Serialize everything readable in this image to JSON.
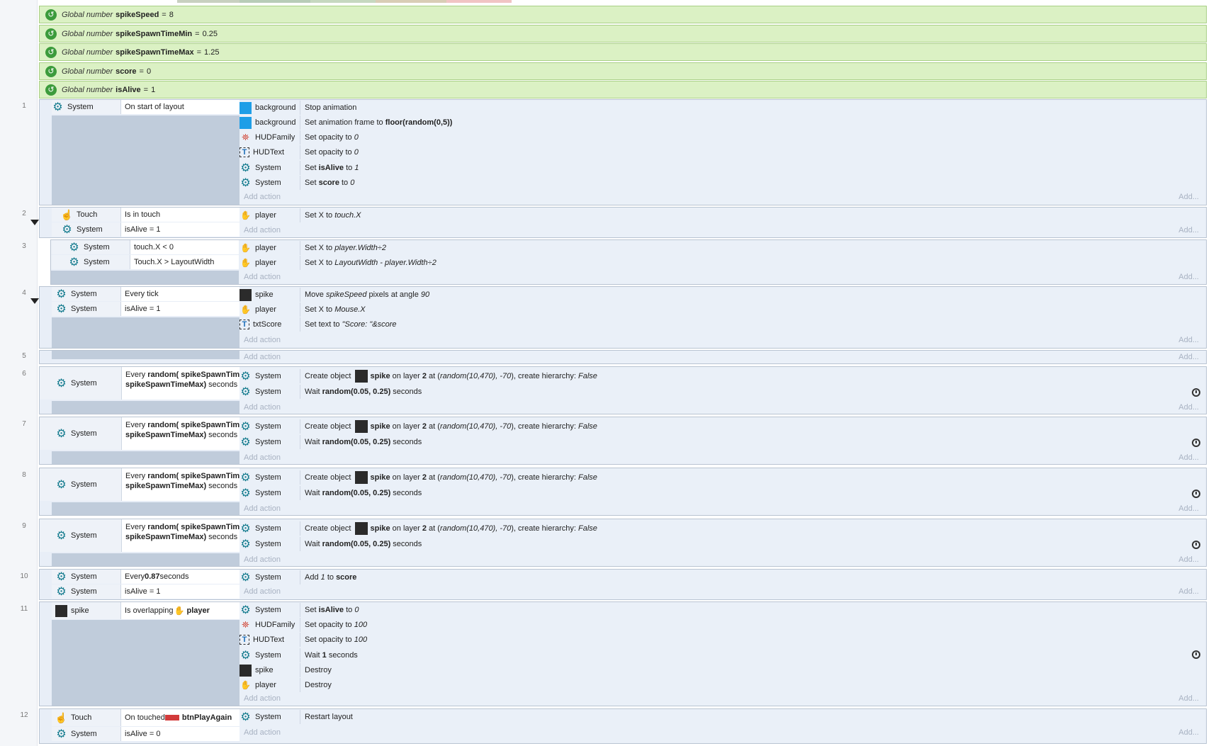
{
  "globals": [
    {
      "kw": "Global number",
      "name": "spikeSpeed",
      "eq": "=",
      "value": "8"
    },
    {
      "kw": "Global number",
      "name": "spikeSpawnTimeMin",
      "eq": "=",
      "value": "0.25"
    },
    {
      "kw": "Global number",
      "name": "spikeSpawnTimeMax",
      "eq": "=",
      "value": "1.25"
    },
    {
      "kw": "Global number",
      "name": "score",
      "eq": "=",
      "value": "0"
    },
    {
      "kw": "Global number",
      "name": "isAlive",
      "eq": "=",
      "value": "1"
    }
  ],
  "labels": {
    "add_action": "Add action",
    "add": "Add..."
  },
  "events": {
    "e1": {
      "num": "1",
      "c1": {
        "obj": "System",
        "text": "On start of layout"
      },
      "a1": {
        "obj": "background",
        "text": "Stop animation"
      },
      "a2": {
        "obj": "background",
        "pre": "Set animation frame to ",
        "b": "floor(random(0,5))"
      },
      "a3": {
        "obj": "HUDFamily",
        "pre": "Set opacity to ",
        "i": "0"
      },
      "a4": {
        "obj": "HUDText",
        "pre": "Set opacity to ",
        "i": "0"
      },
      "a5": {
        "obj": "System",
        "pre": "Set ",
        "b": "isAlive",
        "mid": " to ",
        "i": "1"
      },
      "a6": {
        "obj": "System",
        "pre": "Set ",
        "b": "score",
        "mid": " to ",
        "i": "0"
      }
    },
    "e2": {
      "num": "2",
      "c1": {
        "obj": "Touch",
        "text": "Is in touch"
      },
      "c2": {
        "obj": "System",
        "text": "isAlive = 1"
      },
      "a1": {
        "obj": "player",
        "pre": "Set X to ",
        "i": "touch.X"
      }
    },
    "e3": {
      "num": "3",
      "c1": {
        "obj": "System",
        "text": "touch.X < 0"
      },
      "c2": {
        "obj": "System",
        "text": "Touch.X > LayoutWidth"
      },
      "a1": {
        "obj": "player",
        "pre": "Set X to ",
        "i": "player.Width÷2"
      },
      "a2": {
        "obj": "player",
        "pre": "Set X to ",
        "i": "LayoutWidth - player.Width÷2"
      }
    },
    "e4": {
      "num": "4",
      "c1": {
        "obj": "System",
        "text": "Every tick"
      },
      "c2": {
        "obj": "System",
        "text": "isAlive = 1"
      },
      "a1": {
        "obj": "spike",
        "pre": "Move ",
        "i": "spikeSpeed",
        "post": " pixels at angle ",
        "i2": "90"
      },
      "a2": {
        "obj": "player",
        "pre": "Set X to ",
        "i": "Mouse.X"
      },
      "a3": {
        "obj": "txtScore",
        "pre": "Set text to ",
        "i": "\"Score: \"&score"
      }
    },
    "e5": {
      "num": "5"
    },
    "spawn": {
      "cond_obj": "System",
      "cond_pre": "Every ",
      "cond_b": "random( spikeSpawnTimeMin, spikeSpawnTimeMax)",
      "cond_post": " seconds",
      "create_obj": "System",
      "create_pre": "Create object ",
      "create_b": "spike",
      "create_mid": " on layer ",
      "create_layer": "2",
      "create_at": " at (",
      "create_i": "random(10,470), -70",
      "create_end": "), create hierarchy: ",
      "create_h": "False",
      "wait_obj": "System",
      "wait_pre": "Wait ",
      "wait_b": "random(0.05, 0.25)",
      "wait_post": " seconds"
    },
    "e6": {
      "num": "6"
    },
    "e7": {
      "num": "7"
    },
    "e8": {
      "num": "8"
    },
    "e9": {
      "num": "9"
    },
    "e10": {
      "num": "10",
      "c1": {
        "obj": "System",
        "pre": "Every ",
        "b": "0.87",
        "post": " seconds"
      },
      "c2": {
        "obj": "System",
        "text": "isAlive = 1"
      },
      "a1": {
        "obj": "System",
        "pre": "Add ",
        "i": "1",
        "mid": " to ",
        "b": "score"
      }
    },
    "e11": {
      "num": "11",
      "c1": {
        "obj": "spike",
        "pre": "Is overlapping ",
        "b": "player"
      },
      "a1": {
        "obj": "System",
        "pre": "Set ",
        "b": "isAlive",
        "mid": " to ",
        "i": "0"
      },
      "a2": {
        "obj": "HUDFamily",
        "pre": "Set opacity to ",
        "i": "100"
      },
      "a3": {
        "obj": "HUDText",
        "pre": "Set opacity to ",
        "i": "100"
      },
      "a4": {
        "obj": "System",
        "pre": "Wait ",
        "b": "1",
        "post": " seconds"
      },
      "a5": {
        "obj": "spike",
        "text": "Destroy"
      },
      "a6": {
        "obj": "player",
        "text": "Destroy"
      }
    },
    "e12": {
      "num": "12",
      "c1": {
        "obj": "Touch",
        "pre": "On touched ",
        "b": "btnPlayAgain"
      },
      "c2": {
        "obj": "System",
        "text": "isAlive = 0"
      },
      "a1": {
        "obj": "System",
        "text": "Restart layout"
      }
    }
  },
  "colors": {
    "global_bg": "#dbf1c4",
    "event_bg": "#e8eef7",
    "accent": "#167c8f"
  }
}
